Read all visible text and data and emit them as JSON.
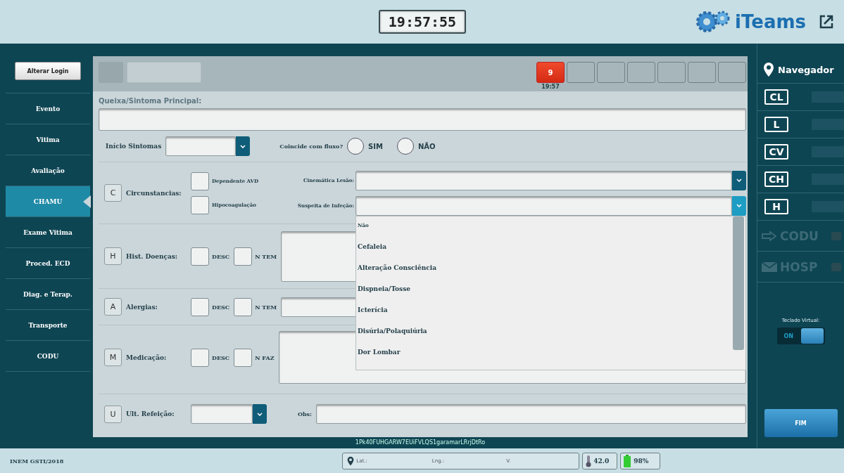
{
  "header": {
    "clock": "19:57:55",
    "logo": "iTeams"
  },
  "sidebar": {
    "login_button": "Alterar Login",
    "items": [
      {
        "label": "Evento",
        "selected": false
      },
      {
        "label": "Vitima",
        "selected": false
      },
      {
        "label": "Avaliação",
        "selected": false
      },
      {
        "label": "CHAMU",
        "selected": true
      },
      {
        "label": "Exame Vitima",
        "selected": false
      },
      {
        "label": "Proced. ECD",
        "selected": false
      },
      {
        "label": "Diag. e Terap.",
        "selected": false
      },
      {
        "label": "Transporte",
        "selected": false
      },
      {
        "label": "CODU",
        "selected": false
      }
    ]
  },
  "toolbar": {
    "alerts": [
      {
        "count": "9",
        "time": "19:57",
        "active": true
      },
      {
        "active": false
      },
      {
        "active": false
      },
      {
        "active": false
      },
      {
        "active": false
      },
      {
        "active": false
      },
      {
        "active": false
      }
    ]
  },
  "form": {
    "complaint": {
      "label": "Queixa/Sintoma Principal:"
    },
    "onset": {
      "label": "Início Sintomas"
    },
    "flow": {
      "label": "Coincide com fluxo?",
      "options": [
        {
          "label": "SIM",
          "selected": false
        },
        {
          "label": "NÃO",
          "selected": false
        }
      ]
    },
    "sections": [
      {
        "kind": "circumstances",
        "letter": "C",
        "label": "Circunstancias:",
        "checks": [
          {
            "label": "Dependente AVD",
            "checked": false
          },
          {
            "label": "Hipocoagulação",
            "checked": false
          }
        ],
        "selects": [
          {
            "label": "Cinemática Lesão:",
            "open": false
          },
          {
            "label": "Suspeita de Infeção:",
            "open": true,
            "options": [
              "Não",
              "Cefaleia",
              "Alteração Consciência",
              "Dispneia/Tosse",
              "Icterícia",
              "Disúria/Polaquiúria",
              "Dor Lombar"
            ]
          }
        ]
      },
      {
        "kind": "notes",
        "letter": "H",
        "label": "Hist. Doenças:",
        "checks": [
          {
            "label": "DESC",
            "checked": false
          },
          {
            "label": "N TEM",
            "checked": false
          }
        ]
      },
      {
        "kind": "line",
        "letter": "A",
        "label": "Alergias:",
        "checks": [
          {
            "label": "DESC",
            "checked": false
          },
          {
            "label": "N TEM",
            "checked": false
          }
        ]
      },
      {
        "kind": "notes",
        "letter": "M",
        "label": "Medicação:",
        "checks": [
          {
            "label": "DESC",
            "checked": false
          },
          {
            "label": "N FAZ",
            "checked": false
          }
        ]
      },
      {
        "kind": "meal",
        "letter": "U",
        "label": "Ult. Refeição:",
        "obs_label": "Obs:"
      }
    ]
  },
  "device_id": "1Pk40FUHGARW7EUiFVLQS1garamarLRrjDtRo",
  "navigator": {
    "title": "Navegador",
    "codes": [
      "CL",
      "L",
      "CV",
      "CH",
      "H"
    ],
    "links": [
      {
        "kind": "arrow",
        "label": "CODU",
        "disabled": true
      },
      {
        "kind": "mail",
        "label": "HOSP",
        "disabled": true
      }
    ],
    "keyboard": {
      "label": "Teclado Virtual:",
      "state_label": "ON",
      "on": true
    },
    "finish": "FIM"
  },
  "status": {
    "org": "INEM GSTI/2018",
    "lat": "Lat.:",
    "lng": "Lng.:",
    "v": "V.",
    "temperature": "42.0",
    "battery": "98%"
  }
}
